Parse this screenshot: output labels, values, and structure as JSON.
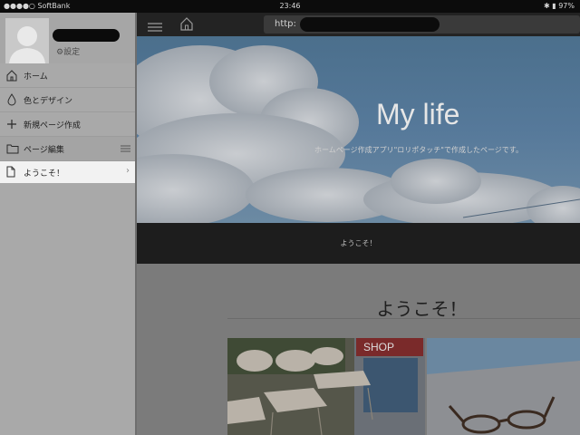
{
  "status_bar": {
    "carrier": "●●●●○ SoftBank",
    "time": "23:46",
    "battery": "✱ ▮ 97%"
  },
  "sidebar": {
    "settings_label": "⚙設定",
    "menu": [
      {
        "label": "ホーム",
        "icon": "home-icon"
      },
      {
        "label": "色とデザイン",
        "icon": "drop-icon"
      },
      {
        "label": "新規ページ作成",
        "icon": "plus-icon"
      },
      {
        "label": "ページ編集",
        "icon": "folder-icon"
      }
    ],
    "pages": [
      {
        "label": "ようこそ！",
        "icon": "document-icon"
      }
    ]
  },
  "browser": {
    "url_prefix": "http:"
  },
  "site": {
    "title": "My life",
    "subtitle": "ホームページ作成アプリ\"ロリポタッチ\"で作成したページです。",
    "nav_link": "ようこそ！",
    "heading": "ようこそ！",
    "photo2_label": "SHOP"
  },
  "colors": {
    "sidebar_bg": "#a9a9a9",
    "selected_bg": "#f2f2f2",
    "toolbar_bg": "#232323",
    "nav_bg": "#1d1d1d"
  }
}
